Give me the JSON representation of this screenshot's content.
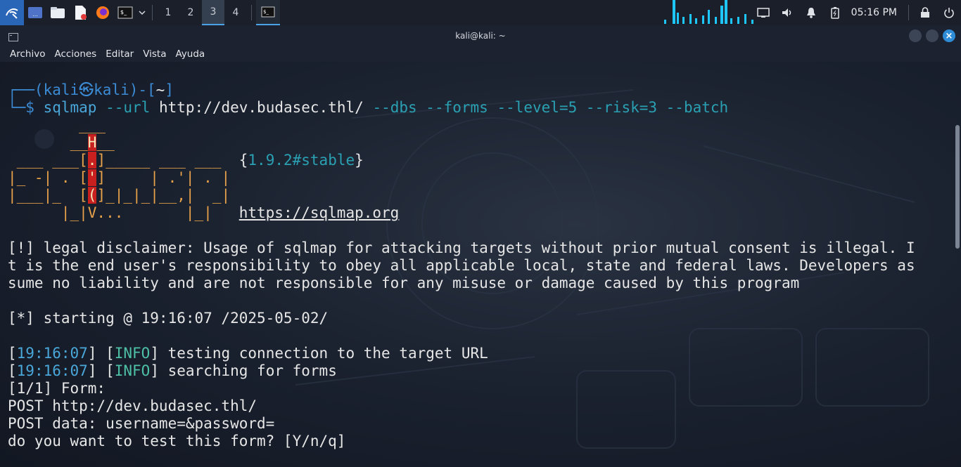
{
  "panel": {
    "workspaces": [
      "1",
      "2",
      "3",
      "4"
    ],
    "active_workspace": "3",
    "clock": "05:16 PM",
    "icons": [
      "kali-menu-icon",
      "desktop-icon",
      "file-manager-icon",
      "text-editor-icon",
      "firefox-icon",
      "terminal-icon",
      "dropdown-icon",
      "terminal-task-icon",
      "display-icon",
      "volume-icon",
      "notification-icon",
      "battery-icon",
      "lock-icon",
      "power-icon"
    ]
  },
  "window": {
    "title": "kali@kali: ~",
    "menu": [
      "Archivo",
      "Acciones",
      "Editar",
      "Vista",
      "Ayuda"
    ]
  },
  "terminal": {
    "prompt_user": "kali",
    "prompt_at": "㉿",
    "prompt_host": "kali",
    "prompt_dir": "~",
    "cmd_name": "sqlmap",
    "cmd_url_flag": "--url",
    "cmd_url": "http://dev.budasec.thl/",
    "cmd_flags": "--dbs --forms --level=5 --risk=3 --batch",
    "version": "1.9.2#stable",
    "site": "https://sqlmap.org",
    "disclaimer_1": "[!] legal disclaimer: Usage of sqlmap for attacking targets without prior mutual consent is illegal. I",
    "disclaimer_2": "t is the end user's responsibility to obey all applicable local, state and federal laws. Developers as",
    "disclaimer_3": "sume no liability and are not responsible for any misuse or damage caused by this program",
    "starting": "[*] starting @ 19:16:07 /2025-05-02/",
    "log_time_1": "19:16:07",
    "log_level_1": "INFO",
    "log_msg_1": "testing connection to the target URL",
    "log_time_2": "19:16:07",
    "log_level_2": "INFO",
    "log_msg_2": "searching for forms",
    "form_1": "[1/1] Form:",
    "form_2": "POST http://dev.budasec.thl/",
    "form_3": "POST data: username=&password=",
    "form_4": "do you want to test this form? [Y/n/q]"
  }
}
